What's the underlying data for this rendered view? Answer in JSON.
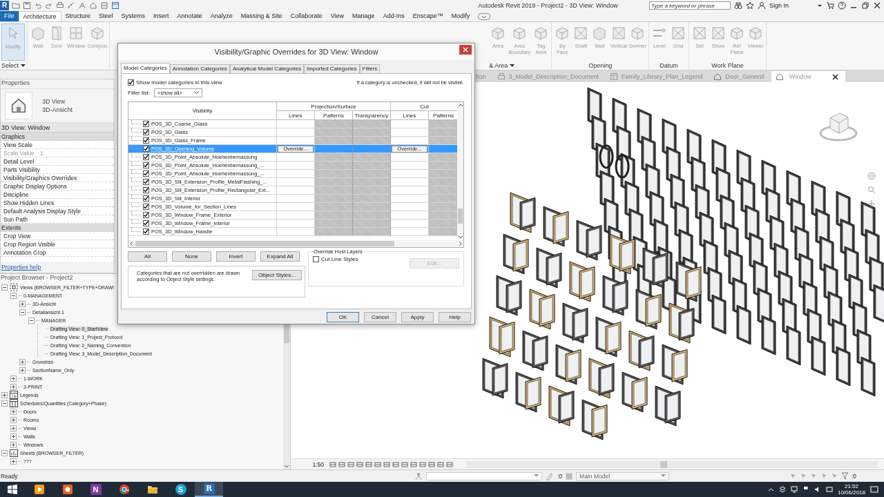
{
  "title_bar": {
    "logo": "R",
    "title": "Autodesk Revit 2019 - Project2 - 3D View: Window",
    "search": {
      "placeholder": "Type a keyword or phrase"
    },
    "sign_in": "Sign In"
  },
  "ribbon": {
    "tabs": [
      {
        "label": "File",
        "kind": "file",
        "selected": false
      },
      {
        "label": "Architecture",
        "kind": "tab",
        "selected": true
      },
      {
        "label": "Structure",
        "kind": "tab",
        "selected": false
      },
      {
        "label": "Steel",
        "kind": "tab",
        "selected": false
      },
      {
        "label": "Systems",
        "kind": "tab",
        "selected": false
      },
      {
        "label": "Insert",
        "kind": "tab",
        "selected": false
      },
      {
        "label": "Annotate",
        "kind": "tab",
        "selected": false
      },
      {
        "label": "Analyze",
        "kind": "tab",
        "selected": false
      },
      {
        "label": "Massing & Site",
        "kind": "tab",
        "selected": false
      },
      {
        "label": "Collaborate",
        "kind": "tab",
        "selected": false
      },
      {
        "label": "View",
        "kind": "tab",
        "selected": false
      },
      {
        "label": "Manage",
        "kind": "tab",
        "selected": false
      },
      {
        "label": "Add-Ins",
        "kind": "tab",
        "selected": false
      },
      {
        "label": "Enscape™",
        "kind": "tab",
        "selected": false
      },
      {
        "label": "Modify",
        "kind": "tab",
        "selected": false
      }
    ],
    "panels_left": [
      {
        "label": "Select",
        "menu": true,
        "tools": [
          {
            "label": "Modify",
            "kind": "pointer",
            "selected": true
          }
        ]
      },
      {
        "tools": [
          {
            "label": "Wall",
            "kind": "wall",
            "selected": false
          },
          {
            "label": "Door",
            "kind": "door",
            "selected": false
          },
          {
            "label": "Window",
            "kind": "window",
            "selected": false
          },
          {
            "label": "Compon",
            "kind": "box",
            "selected": false
          }
        ]
      }
    ],
    "panels_right": [
      {
        "label": "& Area",
        "menu": true,
        "tools": [
          {
            "label": "Area",
            "kind": "box",
            "selected": false
          },
          {
            "label": "Area Boundary",
            "kind": "box",
            "selected": false
          },
          {
            "label": "Tag Area",
            "kind": "box",
            "selected": false
          }
        ]
      },
      {
        "label": "Opening",
        "menu": false,
        "tools": [
          {
            "label": "By Face",
            "kind": "box",
            "selected": false
          },
          {
            "label": "Shaft",
            "kind": "grid",
            "selected": false
          },
          {
            "label": "Wall",
            "kind": "wall",
            "selected": false
          },
          {
            "label": "Vertical",
            "kind": "grid",
            "selected": false
          },
          {
            "label": "Dormer",
            "kind": "box",
            "selected": false
          }
        ]
      },
      {
        "label": "Datum",
        "menu": false,
        "tools": [
          {
            "label": "Level",
            "kind": "level",
            "selected": false
          },
          {
            "label": "Grid",
            "kind": "grid",
            "selected": false
          }
        ]
      },
      {
        "label": "Work Plane",
        "menu": false,
        "tools": [
          {
            "label": "Set",
            "kind": "grid",
            "selected": false
          },
          {
            "label": "Show",
            "kind": "grid",
            "selected": false
          },
          {
            "label": "Ref Plane",
            "kind": "box",
            "selected": false
          },
          {
            "label": "Viewer",
            "kind": "box",
            "selected": false
          }
        ]
      }
    ]
  },
  "properties": {
    "title": "Properties",
    "type_name": "3D View",
    "type_family": "3D-Ansicht",
    "instance": "3D View: Window",
    "rows": [
      {
        "label": "Graphics",
        "kind": "group"
      },
      {
        "label": "View Scale",
        "kind": "param",
        "disabled": false
      },
      {
        "label": "Scale Value",
        "kind": "param",
        "disabled": true,
        "value": "1:"
      },
      {
        "label": "Detail Level",
        "kind": "param",
        "disabled": false
      },
      {
        "label": "Parts Visibility",
        "kind": "param",
        "disabled": false
      },
      {
        "label": "Visibility/Graphics Overrides",
        "kind": "param",
        "disabled": false
      },
      {
        "label": "Graphic Display Options",
        "kind": "param",
        "disabled": false
      },
      {
        "label": "Discipline",
        "kind": "param",
        "disabled": false
      },
      {
        "label": "Show Hidden Lines",
        "kind": "param",
        "disabled": false
      },
      {
        "label": "Default Analysis Display Style",
        "kind": "param",
        "disabled": false
      },
      {
        "label": "Sun Path",
        "kind": "param",
        "disabled": false
      },
      {
        "label": "Extents",
        "kind": "group"
      },
      {
        "label": "Crop View",
        "kind": "param",
        "disabled": false
      },
      {
        "label": "Crop Region Visible",
        "kind": "param",
        "disabled": false
      },
      {
        "label": "Annotation Crop",
        "kind": "param",
        "disabled": false
      }
    ],
    "help_link": "Properties help"
  },
  "browser": {
    "title": "Project Browser - Project2",
    "tree": [
      {
        "label": "Views (BROWSER_FILTER+TYPE+DRAWI",
        "kind": "views",
        "expanded": true,
        "selected": false,
        "children": [
          {
            "label": "0-MANAGEMENT",
            "expanded": true,
            "selected": false,
            "children": [
              {
                "label": "3D-Ansicht",
                "expanded": false,
                "selected": false
              },
              {
                "label": "Detailansicht 1",
                "expanded": true,
                "selected": false,
                "children": [
                  {
                    "label": "MANAGER",
                    "expanded": true,
                    "selected": false,
                    "children": [
                      {
                        "label": "Drafting View: 0_StartView",
                        "selected": true
                      },
                      {
                        "label": "Drafting View: 1_Project_Protocol",
                        "selected": false
                      },
                      {
                        "label": "Drafting View: 2_Naming_Convention",
                        "selected": false
                      },
                      {
                        "label": "Drafting View: 3_Model_Description_Document",
                        "selected": false
                      }
                    ]
                  }
                ]
              },
              {
                "label": "Grundriss",
                "expanded": false,
                "selected": false
              },
              {
                "label": "SectionName_Only",
                "expanded": false,
                "selected": false
              }
            ]
          },
          {
            "label": "1-WORK",
            "expanded": false,
            "selected": false
          },
          {
            "label": "2-PRINT",
            "expanded": false,
            "selected": false
          }
        ]
      },
      {
        "label": "Legends",
        "kind": "legends",
        "expanded": false,
        "selected": false
      },
      {
        "label": "Schedules/Quantities (Category+Phase)",
        "kind": "schedules",
        "expanded": true,
        "selected": false,
        "children": [
          {
            "label": "Doors",
            "expanded": false,
            "selected": false
          },
          {
            "label": "Rooms",
            "expanded": false,
            "selected": false
          },
          {
            "label": "Views",
            "expanded": false,
            "selected": false
          },
          {
            "label": "Walls",
            "expanded": false,
            "selected": false
          },
          {
            "label": "Windows",
            "expanded": false,
            "selected": false
          }
        ]
      },
      {
        "label": "Sheets (BROWSER_FILTER)",
        "kind": "sheets",
        "expanded": true,
        "selected": false,
        "children": [
          {
            "label": "???",
            "expanded": false,
            "selected": false
          }
        ]
      }
    ]
  },
  "view": {
    "tabs": [
      {
        "label": "tion",
        "selected": false
      },
      {
        "label": "3_Model_Description_Document",
        "kind": "drafting",
        "selected": false
      },
      {
        "label": "Family_Library_Plan_Legend",
        "kind": "legend",
        "selected": false
      },
      {
        "label": "Door_General",
        "kind": "model",
        "selected": false
      },
      {
        "label": "Window",
        "kind": "model",
        "selected": true
      }
    ],
    "scale": "1:50"
  },
  "dialog": {
    "title": "Visibility/Graphic Overrides for 3D View: Window",
    "tabs": [
      {
        "label": "Model Categories",
        "selected": true
      },
      {
        "label": "Annotation Categories",
        "selected": false
      },
      {
        "label": "Analytical Model Categories",
        "selected": false
      },
      {
        "label": "Imported Categories",
        "selected": false
      },
      {
        "label": "Filters",
        "selected": false
      }
    ],
    "show_categories": {
      "label": "Show model categories in this view",
      "checked": true
    },
    "hint": "If a category is unchecked, it will not be visible.",
    "filter": {
      "label": "Filter list:",
      "value": "<show all>"
    },
    "table": {
      "visibility_header": "Visibility",
      "groups": [
        {
          "label": "Projection/Surface",
          "columns": [
            {
              "label": "Lines",
              "shaded": false
            },
            {
              "label": "Patterns",
              "shaded": true
            },
            {
              "label": "Transparency",
              "shaded": true
            }
          ]
        },
        {
          "label": "Cut",
          "columns": [
            {
              "label": "Lines",
              "shaded": false
            },
            {
              "label": "Patterns",
              "shaded": true
            }
          ]
        }
      ],
      "rows": [
        {
          "name": "POS_3D_Coarse_Glass",
          "checked": true,
          "selected": false
        },
        {
          "name": "POS_3D_Glass",
          "checked": true,
          "selected": false
        },
        {
          "name": "POS_3D_Glass_Frame",
          "checked": true,
          "selected": false
        },
        {
          "name": "POS_3D_Opening_Volume",
          "checked": true,
          "selected": true,
          "projection_lines": "Override...",
          "cut_lines": "Override..."
        },
        {
          "name": "POS_3D_Point_Absolute_Hoehenbemassung",
          "checked": true,
          "selected": false
        },
        {
          "name": "POS_3D_Point_Absolute_Hoehenbemassung_...",
          "checked": true,
          "selected": false
        },
        {
          "name": "POS_3D_Point_Absolute_Hoehenbemassung_...",
          "checked": true,
          "selected": false
        },
        {
          "name": "POS_3D_Sill_Extension_Profile_MetalFlashing_...",
          "checked": true,
          "selected": false
        },
        {
          "name": "POS_3D_Sill_Extension_Profile_Rectangular_Ext...",
          "checked": true,
          "selected": false
        },
        {
          "name": "POS_3D_Sill_Interior",
          "checked": true,
          "selected": false
        },
        {
          "name": "POS_3D_Volume_for_Section_Lines",
          "checked": true,
          "selected": false
        },
        {
          "name": "POS_3D_Window_Frame_Exterior",
          "checked": true,
          "selected": false
        },
        {
          "name": "POS_3D_Window_Frame_Interior",
          "checked": true,
          "selected": false
        },
        {
          "name": "POS_3D_Window_Handle",
          "checked": true,
          "selected": false
        }
      ]
    },
    "list_buttons": [
      "All",
      "None",
      "Invert",
      "Expand All"
    ],
    "note": "Categories that are not overridden are drawn according to Object Style settings.",
    "object_styles": "Object Styles...",
    "host_layers": {
      "legend": "Override Host Layers",
      "checkbox": {
        "label": "Cut Line Styles",
        "checked": false
      },
      "edit": {
        "label": "Edit...",
        "disabled": true
      }
    },
    "footer_buttons": [
      "OK",
      "Cancel",
      "Apply",
      "Help"
    ]
  },
  "status_bar": {
    "text": "Ready",
    "workset_count": ":0",
    "model": "Main Model",
    "filter_count": ":0"
  },
  "taskbar": {
    "apps": [
      {
        "kind": "media",
        "selected": false
      },
      {
        "kind": "recorder",
        "selected": false
      },
      {
        "kind": "notes",
        "glyph": "N",
        "selected": false
      },
      {
        "kind": "browser",
        "selected": false
      },
      {
        "kind": "folder",
        "selected": false
      },
      {
        "kind": "chat",
        "glyph": "S",
        "selected": false
      },
      {
        "kind": "revit",
        "glyph": "R",
        "selected": true
      }
    ],
    "time": "21:52",
    "date": "10/06/2018"
  }
}
